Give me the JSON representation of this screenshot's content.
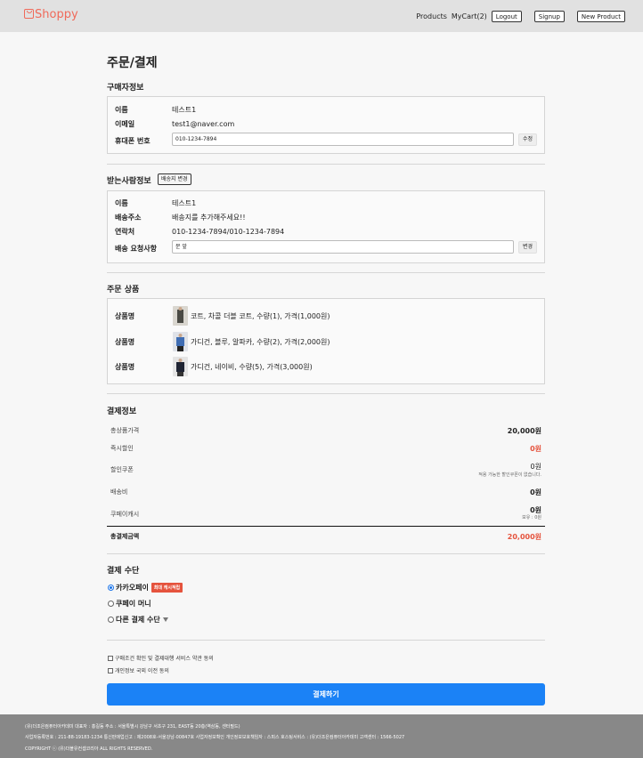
{
  "header": {
    "logo": "Shoppy",
    "nav": {
      "products": "Products",
      "cart": "MyCart(2)",
      "logout": "Logout",
      "signup": "Signup",
      "new_product": "New Product"
    }
  },
  "page_title": "주문/결제",
  "buyer": {
    "title": "구매자정보",
    "name_label": "이름",
    "name": "테스트1",
    "email_label": "이메일",
    "email": "test1@naver.com",
    "phone_label": "휴대폰 번호",
    "phone": "010-1234-7894",
    "edit_button": "수정"
  },
  "receiver": {
    "title": "받는사람정보",
    "change_address_button": "배송지 변경",
    "name_label": "이름",
    "name": "테스트1",
    "address_label": "배송주소",
    "address": "배송지를 추가해주세요!!",
    "contact_label": "연락처",
    "contact": "010-1234-7894/010-1234-7894",
    "request_label": "배송 요청사항",
    "request": "문 앞",
    "change_button": "변경"
  },
  "order_items": {
    "title": "주문 상품",
    "items": [
      {
        "label": "상품명",
        "text": "코트, 차콜 더블 코트, 수량(1), 가격(1,000원)",
        "thumb_color": "#4a4a44"
      },
      {
        "label": "상품명",
        "text": "가디건, 블루, 알파카, 수량(2), 가격(2,000원)",
        "thumb_color": "#3f6db3"
      },
      {
        "label": "상품명",
        "text": "가디건, 네이비, 수량(5), 가격(3,000원)",
        "thumb_color": "#1f2433"
      }
    ]
  },
  "payment_info": {
    "title": "결제정보",
    "total_label": "총상품가격",
    "total": "20,000원",
    "instant_discount_label": "즉시할인",
    "instant_discount": "0원",
    "coupon_label": "할인쿠폰",
    "coupon": "0원",
    "coupon_note": "적용 가능한 할인쿠폰이 없습니다.",
    "shipping_label": "배송비",
    "shipping": "0원",
    "cash_label": "쿠페이캐시",
    "cash": "0원",
    "cash_note": "보유 : 0원",
    "grand_total_label": "총결제금액",
    "grand_total": "20,000원"
  },
  "payment_method": {
    "title": "결제 수단",
    "options": [
      {
        "label": "카카오페이",
        "badge": "최대 캐시적립",
        "selected": true
      },
      {
        "label": "쿠페이 머니",
        "selected": false
      },
      {
        "label": "다른 결제 수단",
        "selected": false
      }
    ]
  },
  "agreements": [
    "구매조건 확인 및 결제대행 서비스 약관 동의",
    "개인정보 국외 이전 동의"
  ],
  "submit_button": "결제하기",
  "footer": {
    "line1": "(유)더조은컴퓨터아카데미 대표자 : 홍길동 주소 : 서울특별시 강남구 서초구 231, EAST동 20층(역삼동, 센터필드)",
    "line2": "사업자등록번호 : 211-88-19183-1234 통신판매업신고 : 제2008호-서울강남-00847호 사업자정보확인 개인정보보호책임자 : 스피스 호스팅서비스 : (유)더조은컴퓨터아카데미 고객센터 : 1566-5027",
    "line3": "COPYRIGHT ⓒ (유)더블유컨셉코리아 ALL RIGHTS RESERVED."
  }
}
